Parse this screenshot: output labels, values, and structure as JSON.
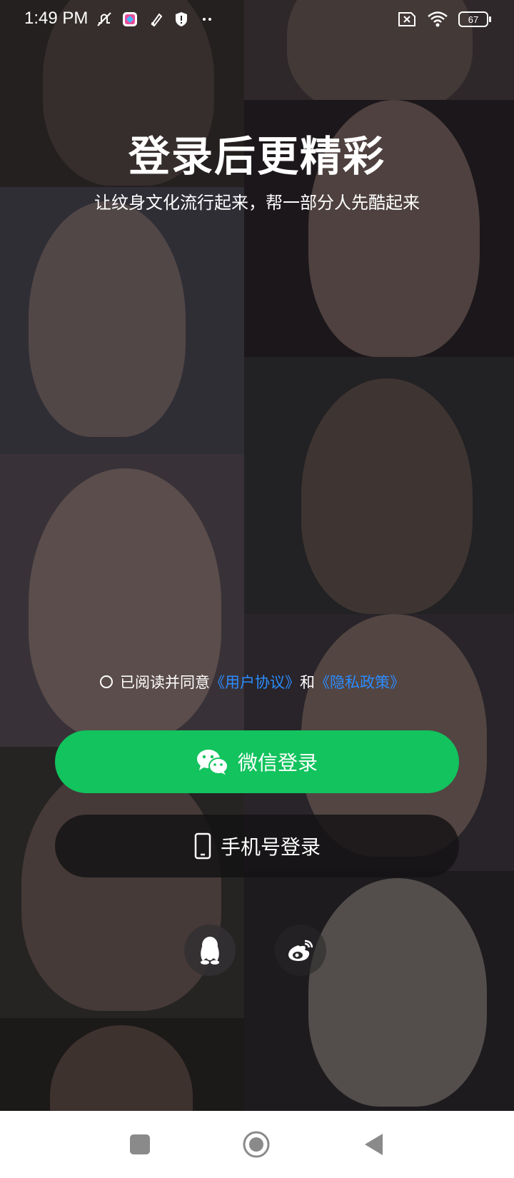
{
  "status_bar": {
    "time": "1:49 PM",
    "left_icons": [
      "mute-icon",
      "app-notification-icon",
      "tool-notification-icon",
      "shield-icon",
      "more-dots-icon"
    ],
    "right_icons": [
      "no-sim-icon",
      "wifi-icon",
      "battery-icon"
    ],
    "battery_level": "67"
  },
  "hero": {
    "title": "登录后更精彩",
    "subtitle": "让纹身文化流行起来，帮一部分人先酷起来"
  },
  "agreement": {
    "prefix": "已阅读并同意",
    "user_agreement": "《用户协议》",
    "conjunction": "和",
    "privacy_policy": "《隐私政策》",
    "checked": false
  },
  "buttons": {
    "wechat_login": "微信登录",
    "phone_login": "手机号登录"
  },
  "social_logins": [
    "qq-icon",
    "weibo-icon"
  ],
  "colors": {
    "wechat_green": "#12c35e",
    "link_blue": "#2b8cff",
    "overlay_dark": "#141214"
  },
  "nav_bar": {
    "buttons": [
      "recents-square-icon",
      "home-circle-icon",
      "back-triangle-icon"
    ]
  }
}
